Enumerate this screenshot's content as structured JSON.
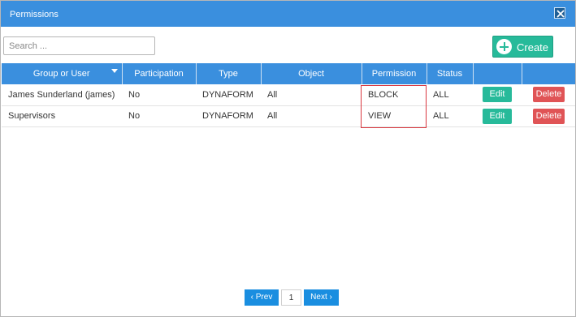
{
  "dialog": {
    "title": "Permissions",
    "close_icon": "close-icon"
  },
  "toolbar": {
    "search_placeholder": "Search ...",
    "search_value": "",
    "create_label": "Create",
    "create_icon": "plus-circle-icon"
  },
  "table": {
    "columns": [
      "Group or User",
      "Participation",
      "Type",
      "Object",
      "Permission",
      "Status",
      "",
      ""
    ],
    "rows": [
      {
        "group_or_user": "James Sunderland (james)",
        "participation": "No",
        "type": "DYNAFORM",
        "object": "All",
        "permission": "BLOCK",
        "status": "ALL",
        "edit_label": "Edit",
        "delete_label": "Delete"
      },
      {
        "group_or_user": "Supervisors",
        "participation": "No",
        "type": "DYNAFORM",
        "object": "All",
        "permission": "VIEW",
        "status": "ALL",
        "edit_label": "Edit",
        "delete_label": "Delete"
      }
    ]
  },
  "pagination": {
    "prev_label": "‹ Prev",
    "page_label": "1",
    "next_label": "Next ›"
  },
  "colors": {
    "header_blue": "#3a8fde",
    "create_green": "#27ba9a",
    "delete_red": "#e05456",
    "highlight_red": "#d9363e"
  }
}
